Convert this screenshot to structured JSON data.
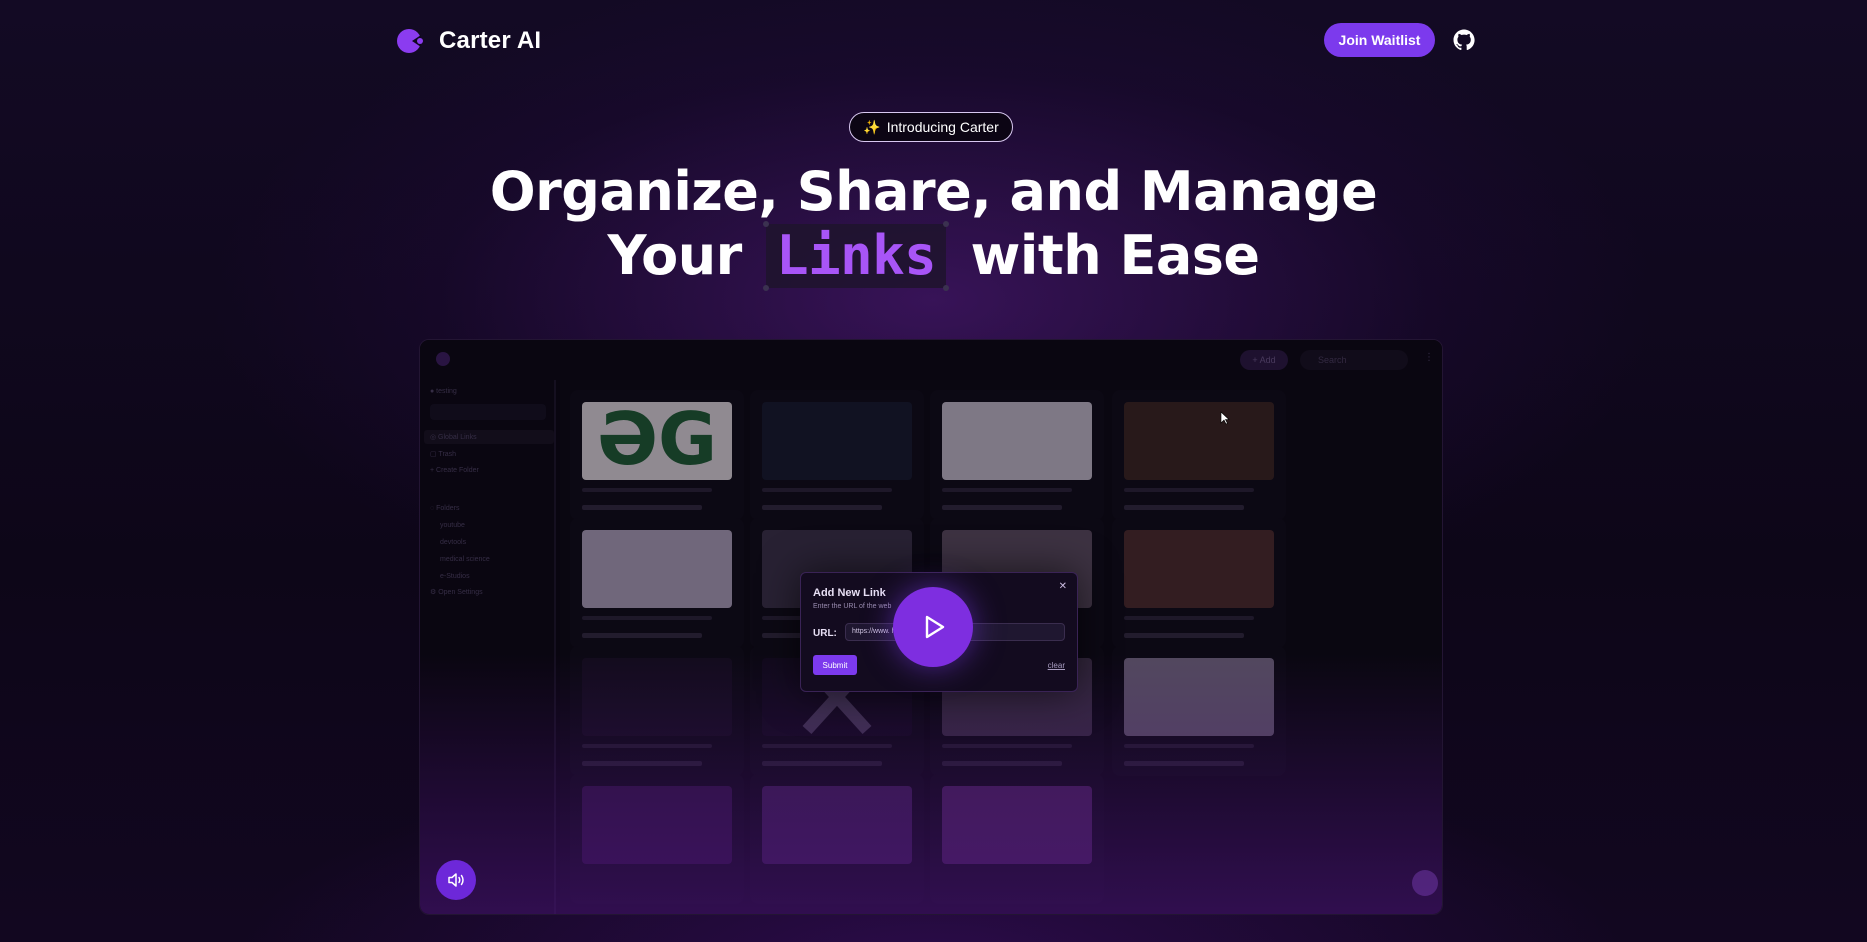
{
  "brand": {
    "name": "Carter AI",
    "accent": "#7c3aed"
  },
  "nav": {
    "waitlist_label": "Join Waitlist",
    "github_icon": "github-icon"
  },
  "hero": {
    "badge_emoji": "✨",
    "badge_text": "Introducing Carter",
    "line1": "Organize, Share, and Manage",
    "line2_before": "Your",
    "line2_highlight": "Links",
    "line2_after": "with Ease"
  },
  "demo": {
    "dialog": {
      "title": "Add New Link",
      "subtitle": "Enter the URL of the web",
      "url_label": "URL:",
      "url_value": "https://www.                      h?v=Q9zv369Gqfk",
      "submit_label": "Submit",
      "clear_label": "clear"
    },
    "play_icon": "play-icon",
    "sound_icon": "speaker-icon"
  }
}
